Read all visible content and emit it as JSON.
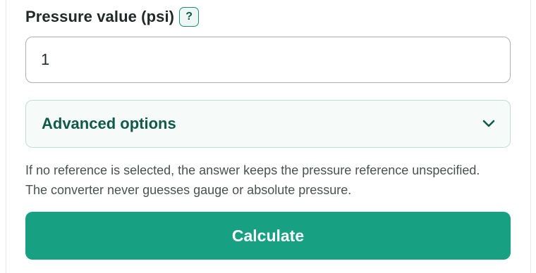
{
  "pressure_field": {
    "label": "Pressure value (psi)",
    "help_label": "?",
    "value": "1"
  },
  "advanced": {
    "label": "Advanced options",
    "icon": "chevron-down-icon"
  },
  "note": {
    "text": "If no reference is selected, the answer keeps the pressure reference unspecified. The converter never guesses gauge or absolute pressure."
  },
  "actions": {
    "calculate_label": "Calculate"
  },
  "colors": {
    "accent": "#18a083",
    "accent_dark": "#0f5a48"
  }
}
